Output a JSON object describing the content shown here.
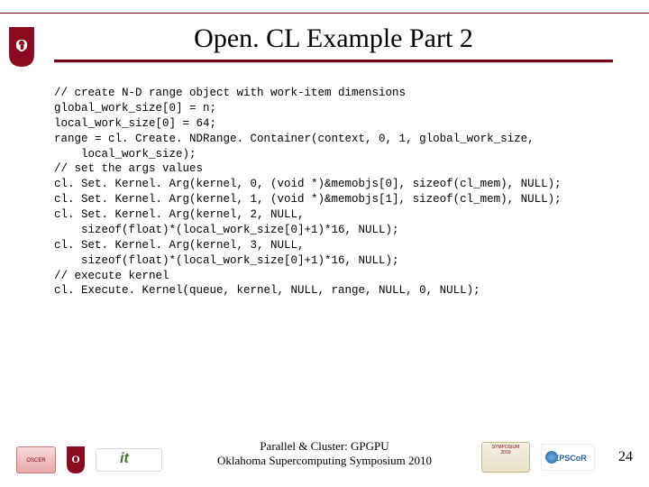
{
  "title": "Open. CL Example Part 2",
  "code": "// create N-D range object with work-item dimensions\nglobal_work_size[0] = n;\nlocal_work_size[0] = 64;\nrange = cl. Create. NDRange. Container(context, 0, 1, global_work_size,\n    local_work_size);\n// set the args values\ncl. Set. Kernel. Arg(kernel, 0, (void *)&memobjs[0], sizeof(cl_mem), NULL);\ncl. Set. Kernel. Arg(kernel, 1, (void *)&memobjs[1], sizeof(cl_mem), NULL);\ncl. Set. Kernel. Arg(kernel, 2, NULL,\n    sizeof(float)*(local_work_size[0]+1)*16, NULL);\ncl. Set. Kernel. Arg(kernel, 3, NULL,\n    sizeof(float)*(local_work_size[0]+1)*16, NULL);\n// execute kernel\ncl. Execute. Kernel(queue, kernel, NULL, range, NULL, 0, NULL);",
  "footer": {
    "line1": "Parallel & Cluster: GPGPU",
    "line2": "Oklahoma Supercomputing Symposium 2010"
  },
  "page_number": "24",
  "logos": {
    "ou": "OU",
    "oscer": "OSCER",
    "it": "information technology",
    "symposium": "OKLAHOMA SUPERCOMPUTING SYMPOSIUM 2010",
    "epscor": "EPSCoR"
  }
}
